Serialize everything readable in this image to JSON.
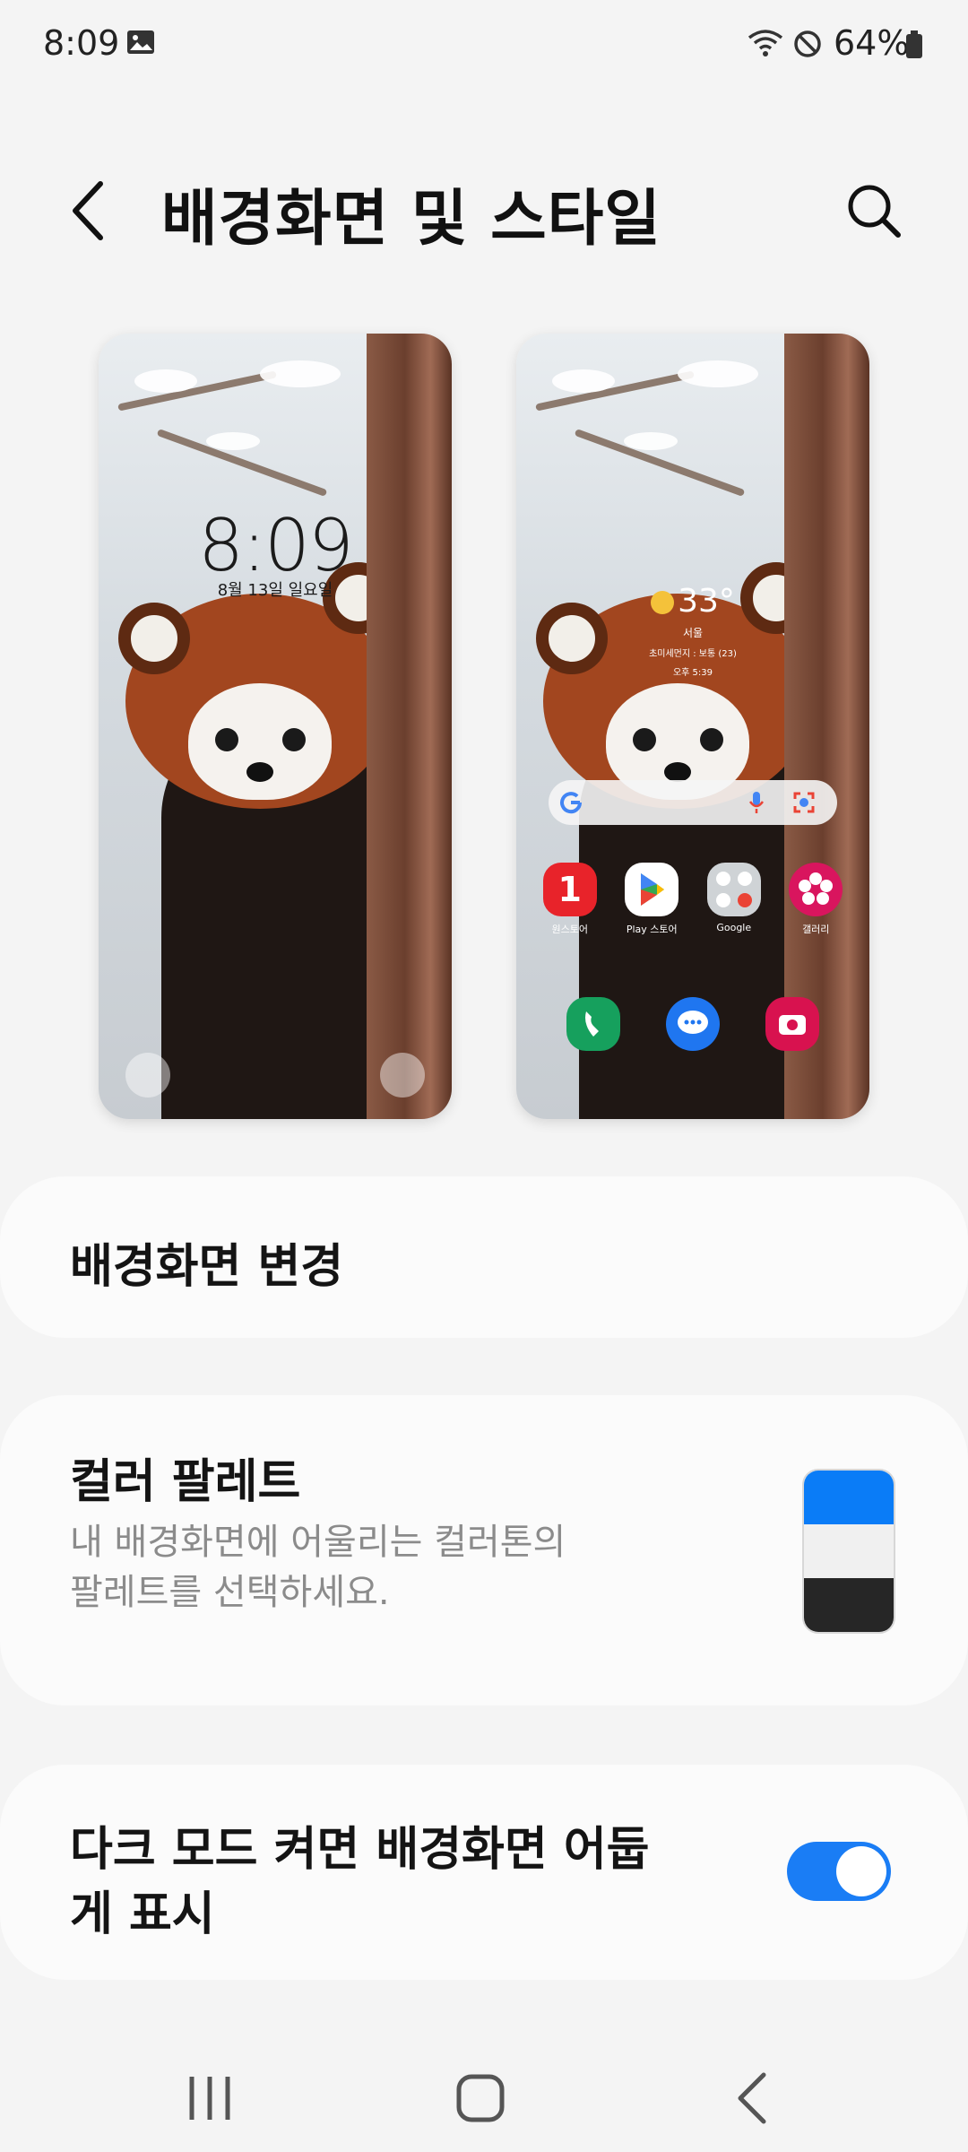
{
  "status_bar": {
    "time": "8:09",
    "battery": "64%",
    "icons": [
      "gallery-icon",
      "wifi-icon",
      "do-not-disturb-icon",
      "battery-icon"
    ]
  },
  "header": {
    "title": "배경화면 및 스타일",
    "back_icon": "chevron-left-icon",
    "search_icon": "search-icon"
  },
  "previews": {
    "lock": {
      "time": "8:09",
      "date": "8월 13일 일요일"
    },
    "home": {
      "weather": {
        "temp": "33°",
        "city": "서울",
        "dust": "초미세먼지 : 보통 (23)",
        "time": "오후 5:39"
      },
      "apps": [
        {
          "label": "원스토어",
          "icon": "onestore-icon",
          "color": "#e8232a"
        },
        {
          "label": "Play 스토어",
          "icon": "play-store-icon",
          "color": "#ffffff"
        },
        {
          "label": "Google",
          "icon": "google-folder-icon",
          "color": "#cfd3d6"
        },
        {
          "label": "갤러리",
          "icon": "gallery-app-icon",
          "color": "#d9155e"
        }
      ],
      "dock": [
        {
          "icon": "phone-icon",
          "color": "#16a05d"
        },
        {
          "icon": "messages-icon",
          "color": "#1f76f0"
        },
        {
          "icon": "camera-icon",
          "color": "#d8124f"
        }
      ]
    }
  },
  "cards": {
    "change_wallpaper": {
      "title": "배경화면 변경"
    },
    "color_palette": {
      "title": "컬러 팔레트",
      "subtitle_line1": "내 배경화면에 어울리는 컬러톤의",
      "subtitle_line2": "팔레트를 선택하세요.",
      "colors": [
        "#0a7cf7",
        "#f0f0f0",
        "#262626"
      ]
    },
    "dark_mode": {
      "title_line1": "다크 모드 켜면 배경화면 어둡",
      "title_line2": "게 표시",
      "enabled": true
    }
  },
  "nav": {
    "recents_icon": "recents-icon",
    "home_icon": "home-icon",
    "back_icon": "back-icon"
  },
  "colors": {
    "accent": "#1a7df5",
    "background": "#f4f4f4",
    "card": "#fbfbfb"
  }
}
